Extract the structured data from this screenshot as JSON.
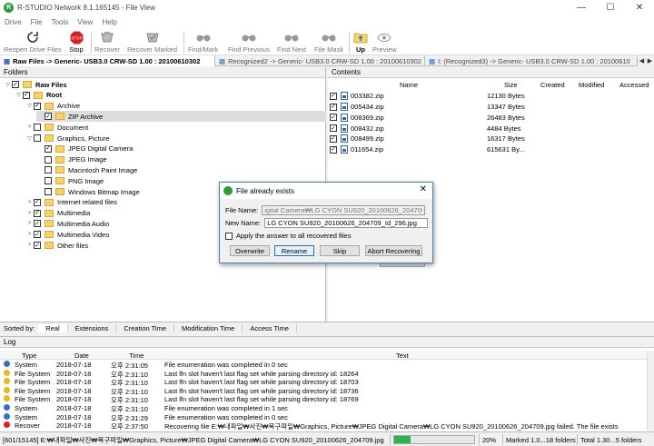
{
  "window": {
    "title": "R-STUDIO Network 8.1.165145 - File View",
    "minimize": "—",
    "maximize": "☐",
    "close": "✕"
  },
  "menu": [
    "Drive",
    "File",
    "Tools",
    "View",
    "Help"
  ],
  "toolbar": [
    {
      "label": "Reopen Drive Files",
      "icon": "reopen-icon",
      "active": false
    },
    {
      "label": "Stop",
      "icon": "stop-icon",
      "active": true
    },
    {
      "label": "Recover",
      "icon": "recover-icon",
      "active": false
    },
    {
      "label": "Recover Marked",
      "icon": "recover-marked-icon",
      "active": false
    },
    {
      "label": "Find/Mark",
      "icon": "find-mark-icon",
      "active": false
    },
    {
      "label": "Find Previous",
      "icon": "find-previous-icon",
      "active": false
    },
    {
      "label": "Find Next",
      "icon": "find-next-icon",
      "active": false
    },
    {
      "label": "File Mask",
      "icon": "file-mask-icon",
      "active": false
    },
    {
      "label": "Up",
      "icon": "up-folder-icon",
      "active": true
    },
    {
      "label": "Preview",
      "icon": "preview-icon",
      "active": false
    }
  ],
  "tabs": [
    "Raw Files -> Generic- USB3.0 CRW-SD 1.00 : 20100610302",
    "Recognized2 -> Generic- USB3.0 CRW-SD 1.00 : 20100610302",
    "I: (Recognized3) -> Generic- USB3.0 CRW-SD 1.00 : 20100610"
  ],
  "folders": {
    "header": "Folders",
    "tree": [
      {
        "label": "Raw Files",
        "level": 0,
        "expander": "▽",
        "checked": "✓",
        "bold": true
      },
      {
        "label": "Root",
        "level": 1,
        "expander": "▽",
        "checked": "✓",
        "bold": true
      },
      {
        "label": "Archive",
        "level": 2,
        "expander": "▽",
        "checked": "✓",
        "bold": false
      },
      {
        "label": "ZIP Archive",
        "level": 3,
        "expander": "",
        "checked": "✓",
        "bold": false,
        "selected": true
      },
      {
        "label": "Document",
        "level": 2,
        "expander": ">",
        "checked": "",
        "bold": false
      },
      {
        "label": "Graphics, Picture",
        "level": 2,
        "expander": "▽",
        "checked": "",
        "bold": false
      },
      {
        "label": "JPEG Digital Camera",
        "level": 3,
        "expander": "",
        "checked": "✓",
        "bold": false
      },
      {
        "label": "JPEG Image",
        "level": 3,
        "expander": "",
        "checked": "",
        "bold": false
      },
      {
        "label": "Macintosh Paint Image",
        "level": 3,
        "expander": "",
        "checked": "",
        "bold": false
      },
      {
        "label": "PNG Image",
        "level": 3,
        "expander": "",
        "checked": "",
        "bold": false
      },
      {
        "label": "Windows Bitmap Image",
        "level": 3,
        "expander": "",
        "checked": "",
        "bold": false
      },
      {
        "label": "Internet related files",
        "level": 2,
        "expander": ">",
        "checked": "✓",
        "bold": false
      },
      {
        "label": "Multimedia",
        "level": 2,
        "expander": ">",
        "checked": "✓",
        "bold": false
      },
      {
        "label": "Multimedia Audio",
        "level": 2,
        "expander": ">",
        "checked": "✓",
        "bold": false
      },
      {
        "label": "Multimedia Video",
        "level": 2,
        "expander": ">",
        "checked": "✓",
        "bold": false
      },
      {
        "label": "Other files",
        "level": 2,
        "expander": ">",
        "checked": "✓",
        "bold": false
      }
    ]
  },
  "contents": {
    "header": "Contents",
    "columns": [
      "Name",
      "Size",
      "Created",
      "Modified",
      "Accessed"
    ],
    "files": [
      {
        "name": "003382.zip",
        "size": "12130 Bytes"
      },
      {
        "name": "005434.zip",
        "size": "13347 Bytes"
      },
      {
        "name": "008369.zip",
        "size": "26483 Bytes"
      },
      {
        "name": "008432.zip",
        "size": "4484 Bytes"
      },
      {
        "name": "008499.zip",
        "size": "16317 Bytes"
      },
      {
        "name": "011654.zip",
        "size": "615631 By..."
      }
    ]
  },
  "sort": {
    "label": "Sorted by:",
    "options": [
      "Real",
      "Extensions",
      "Creation Time",
      "Modification Time",
      "Access Time"
    ],
    "active": 0
  },
  "log": {
    "header": "Log",
    "columns": [
      "Type",
      "Date",
      "Time",
      "Text"
    ],
    "rows": [
      {
        "type": "System",
        "level": "info",
        "date": "2018-07-18",
        "time": "오후 2:31:05",
        "text": "File enumeration was completed in 0 sec"
      },
      {
        "type": "File System",
        "level": "warn",
        "date": "2018-07-18",
        "time": "오후 2:31:10",
        "text": "Last lfn slot haven't last flag set while parsing directory id: 18264"
      },
      {
        "type": "File System",
        "level": "warn",
        "date": "2018-07-18",
        "time": "오후 2:31:10",
        "text": "Last lfn slot haven't last flag set while parsing directory id: 18703"
      },
      {
        "type": "File System",
        "level": "warn",
        "date": "2018-07-18",
        "time": "오후 2:31:10",
        "text": "Last lfn slot haven't last flag set while parsing directory id: 18736"
      },
      {
        "type": "File System",
        "level": "warn",
        "date": "2018-07-18",
        "time": "오후 2:31:10",
        "text": "Last lfn slot haven't last flag set while parsing directory id: 18769"
      },
      {
        "type": "System",
        "level": "info",
        "date": "2018-07-18",
        "time": "오후 2:31:10",
        "text": "File enumeration was completed in 1 sec"
      },
      {
        "type": "System",
        "level": "info",
        "date": "2018-07-18",
        "time": "오후 2:31:29",
        "text": "File enumeration was completed in 0 sec"
      },
      {
        "type": "Recover",
        "level": "err",
        "date": "2018-07-18",
        "time": "오후 2:37:50",
        "text": "Recovering file E:₩내파일₩사진₩복구파일₩Graphics, Picture₩JPEG Digital Camera₩LG CYON SU920_20100626_204709.jpg failed. The file exists"
      }
    ]
  },
  "status": {
    "count": "[601/15145]",
    "path": "E:₩내파일₩사진₩복구파일₩Graphics, Picture₩JPEG Digital Camera₩LG CYON SU920_20100626_204709.jpg",
    "progress_percent": 20,
    "progress_label": "20%",
    "marked": "Marked 1.0...18 folders",
    "total": "Total 1.30...5 folders"
  },
  "dialog": {
    "title": "File already exists",
    "file_name_label": "File Name:",
    "file_name_value": "igital Camera₩LG CYON SU920_20100626_204709.jpg",
    "new_name_label": "New Name:",
    "new_name_value": "LG CYON SU920_20100626_204709_Id_296.jpg",
    "apply_all": "Apply the answer to all recovered files",
    "buttons": [
      "Overwrite",
      "Rename",
      "Skip",
      "Abort Recovering"
    ]
  },
  "colors": {
    "accent": "#2a6dc3",
    "progress": "#2db34a",
    "stop": "#d22222",
    "folder": "#f5d26b"
  }
}
